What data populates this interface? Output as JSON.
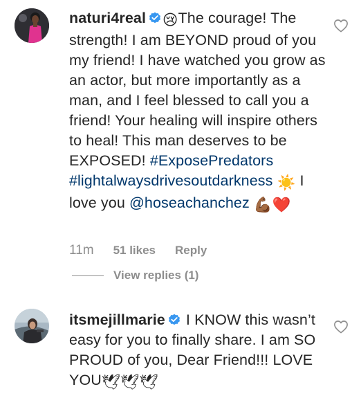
{
  "comments": [
    {
      "username": "naturi4real",
      "verified_icon": "verified-badge-icon",
      "text_emoji_lead": "😢",
      "text_main": "The courage! The strength! I am BEYOND proud of you my friend! I have watched you grow as an actor, but more importantly as a man, and I feel blessed to call you a friend! Your healing will inspire others to heal! This man deserves to be EXPOSED!",
      "hashtag_1": "#ExposePredators",
      "hashtag_2": "#lightalwaysdrivesoutdarkness",
      "emoji_sun": "☀️",
      "text_love": "I love you",
      "mention": "@hoseachanchez",
      "emoji_tail": "💪🏾❤️",
      "time": "11m",
      "likes": "51 likes",
      "reply_label": "Reply",
      "view_replies": "View replies (1)"
    },
    {
      "username": "itsmejillmarie",
      "verified_icon": "verified-badge-icon",
      "text_main": "I KNOW this wasn’t easy for you to finally share. I am SO PROUD of you, Dear Friend!!! LOVE YOU",
      "emoji_tail": "🕊🕊🕊"
    }
  ],
  "colors": {
    "text": "#262626",
    "secondary": "#8e8e8e",
    "link": "#00376b",
    "verified": "#3897f0"
  }
}
